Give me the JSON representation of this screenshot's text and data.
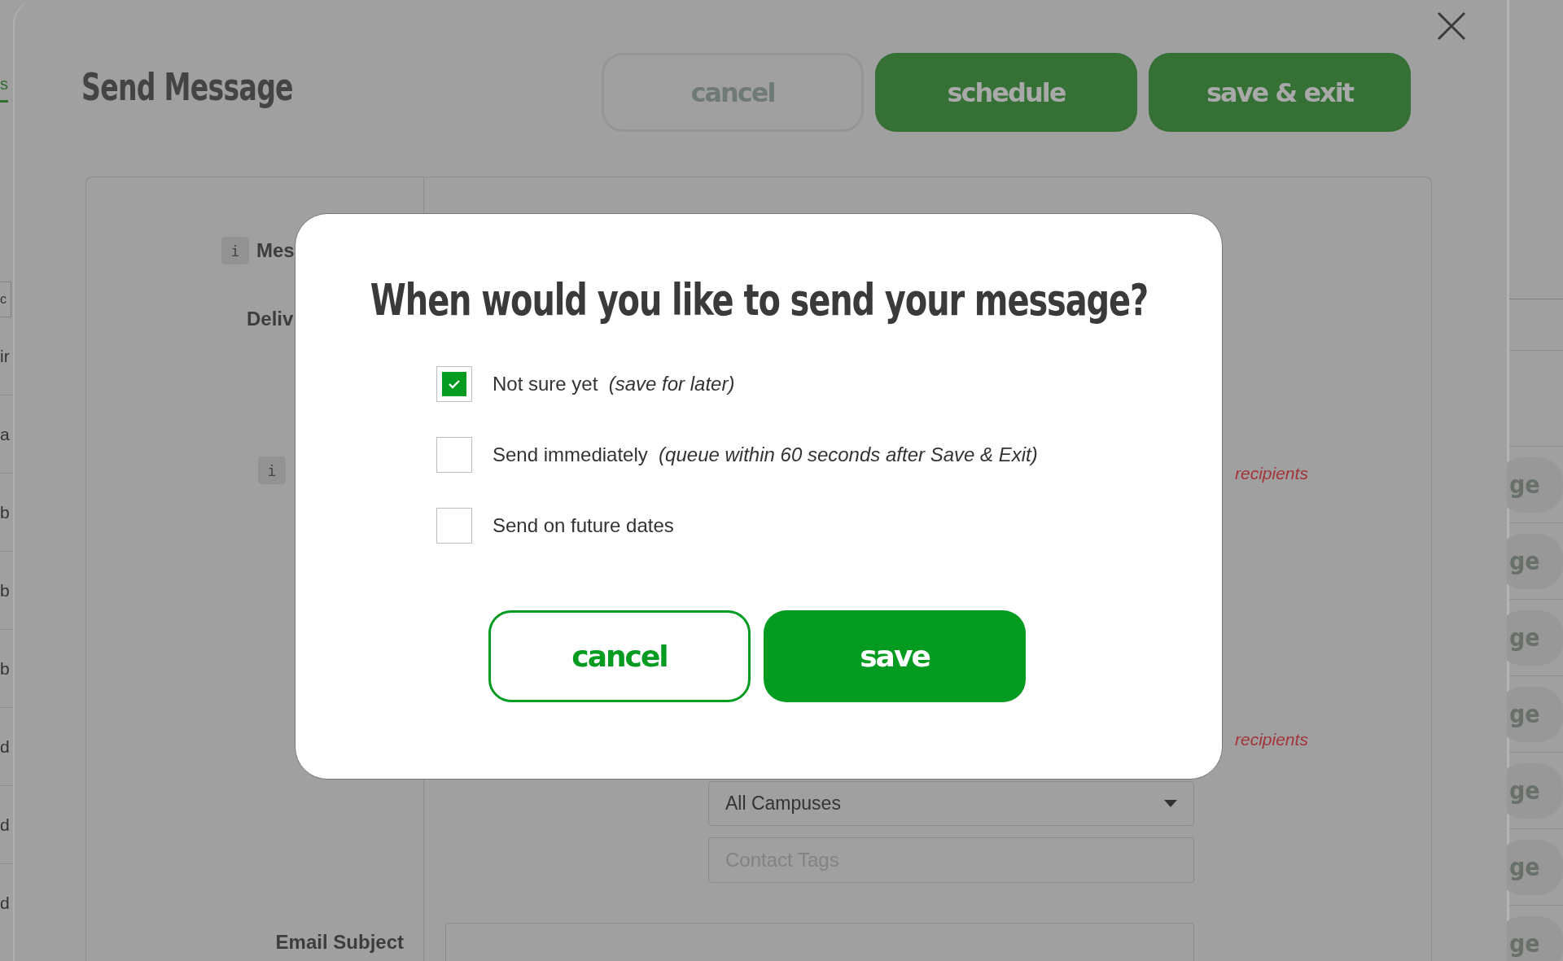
{
  "background_left": {
    "tab": "s",
    "field": "c",
    "rows": [
      "ir",
      "a",
      "b",
      "b",
      "b",
      "d",
      "d",
      "d"
    ]
  },
  "background_right": {
    "rows": [
      "ge",
      "ge",
      "ge",
      "ge",
      "ge",
      "ge",
      "ge"
    ]
  },
  "panel": {
    "title": "Send Message",
    "buttons": [
      {
        "label": "cancel",
        "kind": "outline"
      },
      {
        "label": "schedule",
        "kind": "filled"
      },
      {
        "label": "save & exit",
        "kind": "filled"
      }
    ]
  },
  "form": {
    "info_badges": [
      "i",
      "i"
    ],
    "label_1": "Mes",
    "label_2": "Deliv",
    "label_3": "Email Subject",
    "recipients": [
      "recipients",
      "recipients"
    ],
    "campus_select": {
      "value": "All Campuses"
    },
    "tags_field": {
      "placeholder": "Contact Tags"
    }
  },
  "dialog": {
    "title": "When would you like to send your message?",
    "options": [
      {
        "label": "Not sure yet",
        "note": "(save for later)",
        "checked": true
      },
      {
        "label": "Send immediately",
        "note": "(queue within 60 seconds after Save & Exit)",
        "checked": false
      },
      {
        "label": "Send on future dates",
        "checked": false
      }
    ],
    "buttons": [
      {
        "label": "cancel",
        "kind": "outline"
      },
      {
        "label": "save",
        "kind": "filled"
      }
    ]
  }
}
